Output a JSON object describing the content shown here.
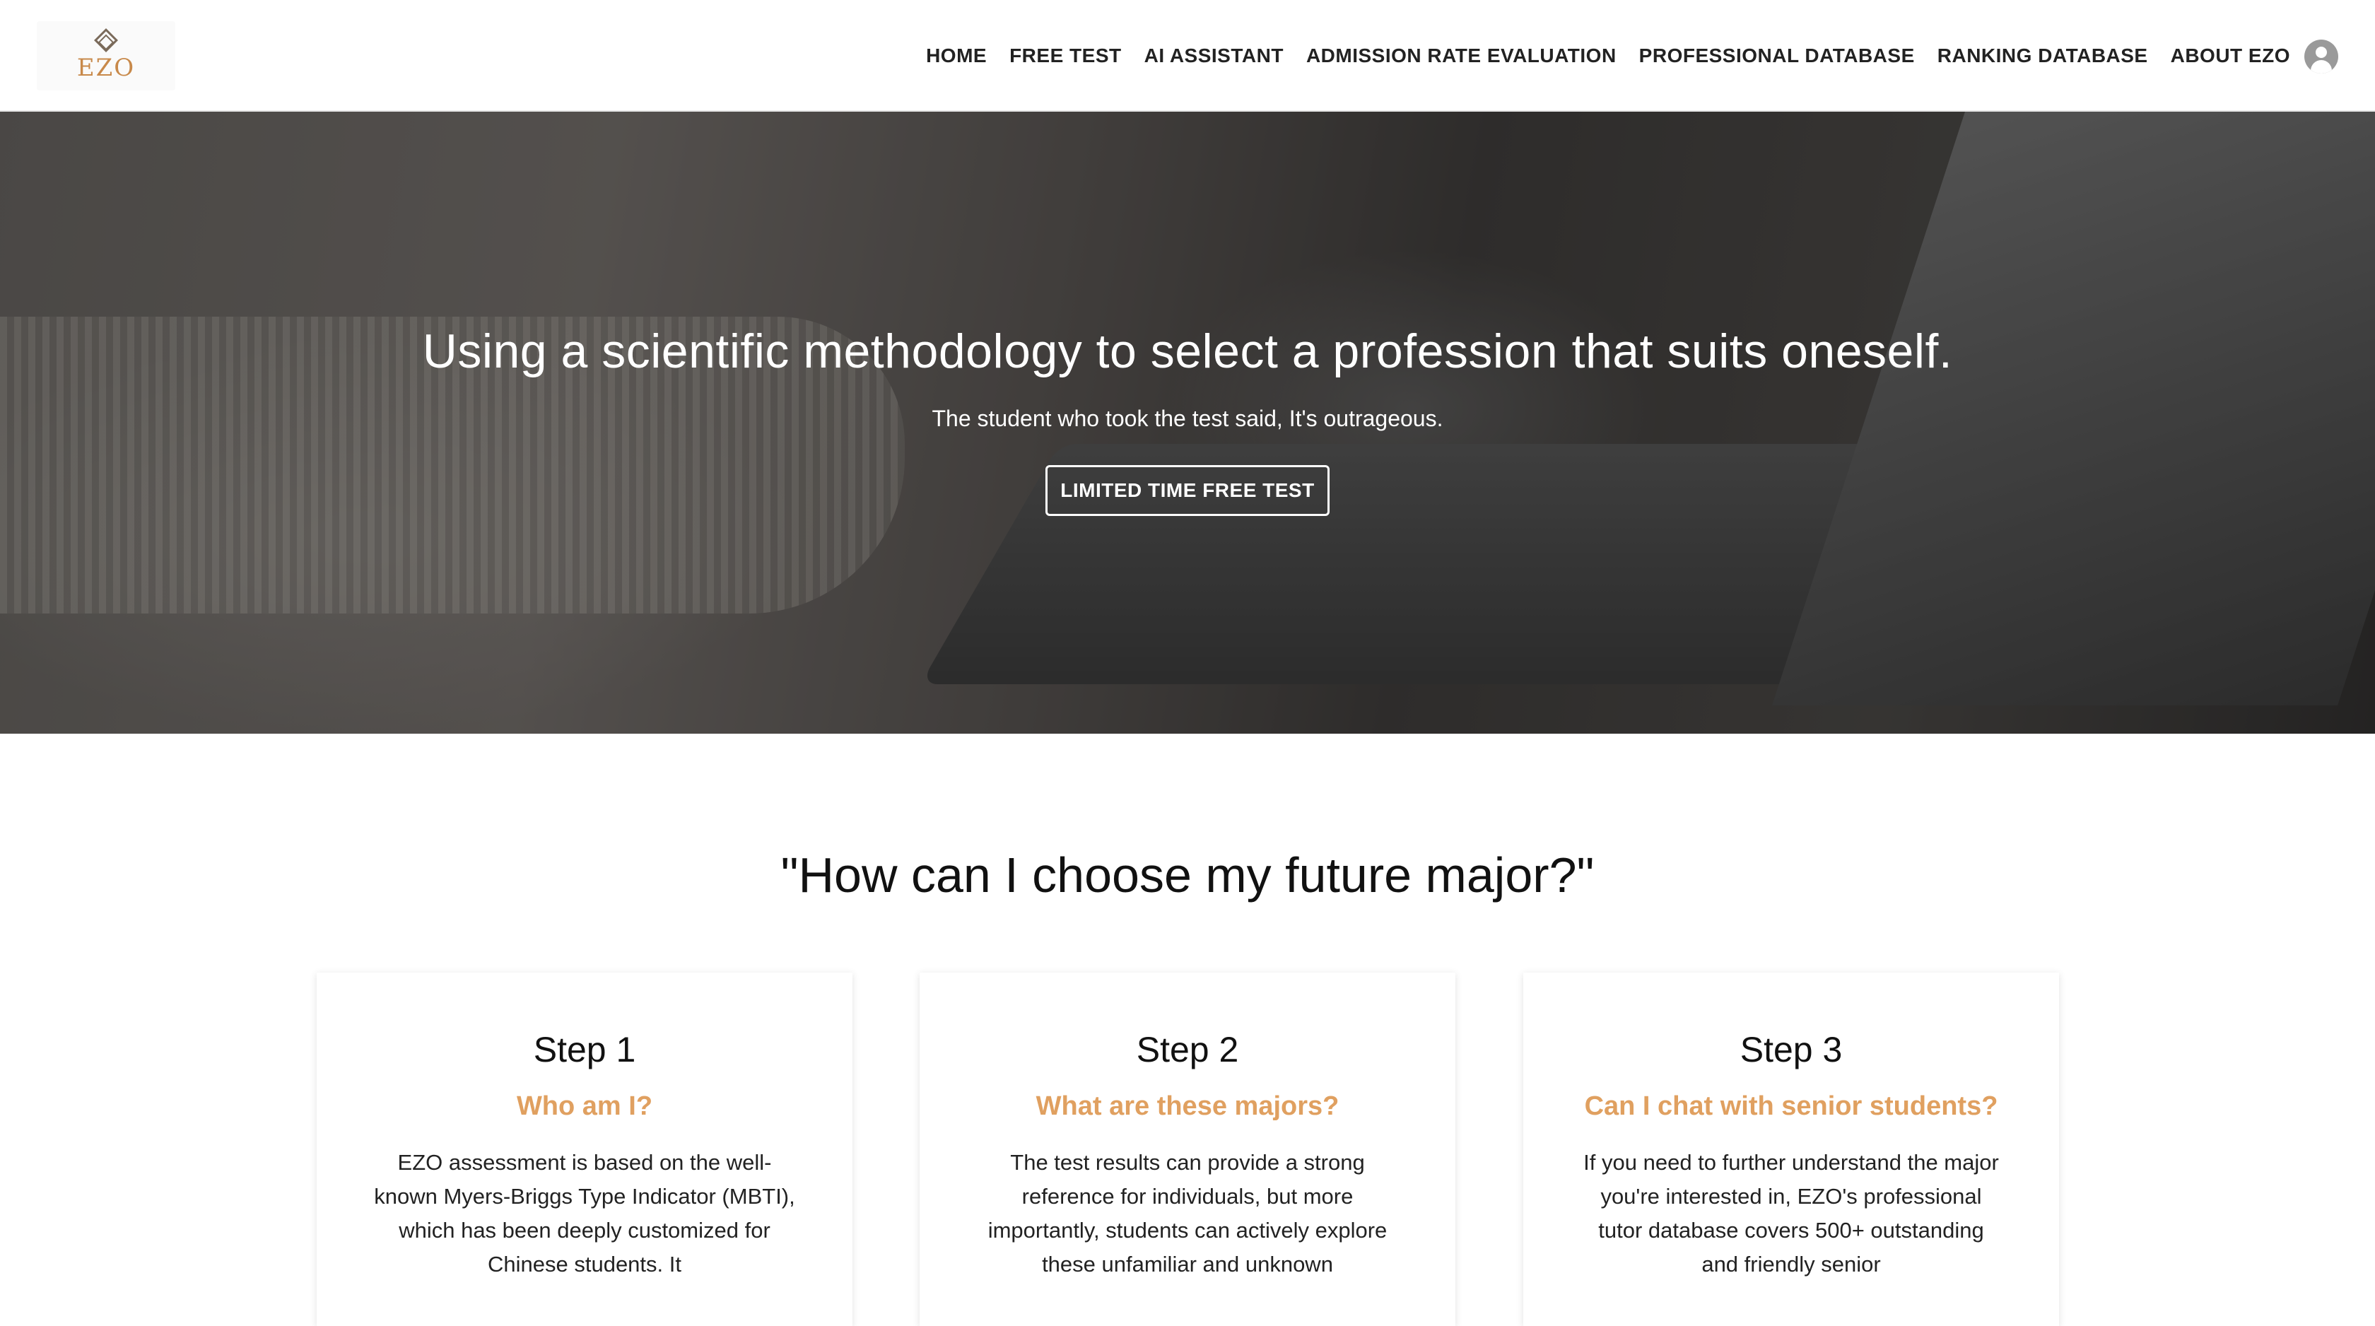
{
  "logo": {
    "text": "EZO"
  },
  "nav": {
    "items": [
      {
        "label": "HOME"
      },
      {
        "label": "FREE TEST"
      },
      {
        "label": "AI ASSISTANT"
      },
      {
        "label": "ADMISSION RATE EVALUATION"
      },
      {
        "label": "PROFESSIONAL DATABASE"
      },
      {
        "label": "RANKING DATABASE"
      },
      {
        "label": "ABOUT EZO"
      }
    ],
    "avatar_icon": "user-avatar-icon"
  },
  "hero": {
    "title": "Using a scientific methodology to select a profession that suits oneself.",
    "subtitle": "The student who took the test said, It's outrageous.",
    "cta_label": "LIMITED TIME FREE TEST"
  },
  "section": {
    "title": "\"How can I choose my future major?\""
  },
  "steps": [
    {
      "step": "Step 1",
      "question": "Who am I?",
      "description": "EZO assessment is based on the well-known Myers-Briggs Type Indicator (MBTI), which has been deeply customized for Chinese students. It"
    },
    {
      "step": "Step 2",
      "question": "What are these majors?",
      "description": "The test results can provide a strong reference for individuals, but more importantly, students can actively explore these unfamiliar and unknown"
    },
    {
      "step": "Step 3",
      "question": "Can I chat with senior students?",
      "description": "If you need to further understand the major you're interested in, EZO's professional tutor database covers 500+ outstanding and friendly senior"
    }
  ],
  "colors": {
    "accent": "#e0a060",
    "logo": "#c8894a",
    "nav_text": "#222222"
  }
}
